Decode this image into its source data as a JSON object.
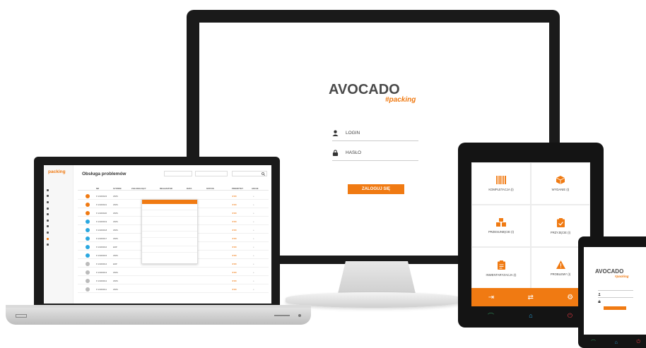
{
  "desktop": {
    "logo_main": "AVOCADO",
    "logo_sub": "#packing",
    "login_label": "LOGIN",
    "password_label": "HASŁO",
    "submit_label": "ZALOGUJ SIĘ"
  },
  "laptop": {
    "brand": "packing",
    "page_title": "Obsługa problemów",
    "columns": [
      "NR",
      "NR ZAM",
      "SYSTEM",
      "ZGŁASZAJĄCY",
      "REALIZATOR",
      "DATA",
      "STATUS",
      "PRIORYTET",
      "AKCJE"
    ],
    "rows": [
      {
        "code": "P-19000023",
        "system": "WMS"
      },
      {
        "code": "P-19000021",
        "system": "WMS"
      },
      {
        "code": "P-19000020",
        "system": "WMS"
      },
      {
        "code": "P-19000019",
        "system": "WMS"
      },
      {
        "code": "P-19000018",
        "system": "WMS"
      },
      {
        "code": "P-19000017",
        "system": "WMS"
      },
      {
        "code": "P-19000016",
        "system": "ERP"
      },
      {
        "code": "P-19000015",
        "system": "WMS"
      },
      {
        "code": "P-19000014",
        "system": "ERP"
      },
      {
        "code": "P-19000013",
        "system": "WMS"
      },
      {
        "code": "P-19000012",
        "system": "WMS"
      },
      {
        "code": "P-19000011",
        "system": "WMS"
      }
    ],
    "status_colors": [
      "#f07a12",
      "#f07a12",
      "#f07a12",
      "#2aa7e0",
      "#2aa7e0",
      "#2aa7e0",
      "#2aa7e0",
      "#2aa7e0",
      "#bbbbbb",
      "#bbbbbb",
      "#bbbbbb",
      "#bbbbbb"
    ]
  },
  "tablet": {
    "tiles": [
      {
        "label": "KOMPLETACJA (I)",
        "icon": "barcode-icon"
      },
      {
        "label": "WYDANIE (I)",
        "icon": "box-icon"
      },
      {
        "label": "PRZESUNIĘCIE (I)",
        "icon": "boxes-icon"
      },
      {
        "label": "PRZYJĘCIE (I)",
        "icon": "clipboard-check-icon"
      },
      {
        "label": "INWENTARYZACJA (I)",
        "icon": "clipboard-icon"
      },
      {
        "label": "PROBLEMY (I)",
        "icon": "warning-icon"
      }
    ]
  },
  "phone": {
    "logo_main": "AVOCADO",
    "logo_sub": "#packing"
  },
  "accent_color": "#f07a12"
}
